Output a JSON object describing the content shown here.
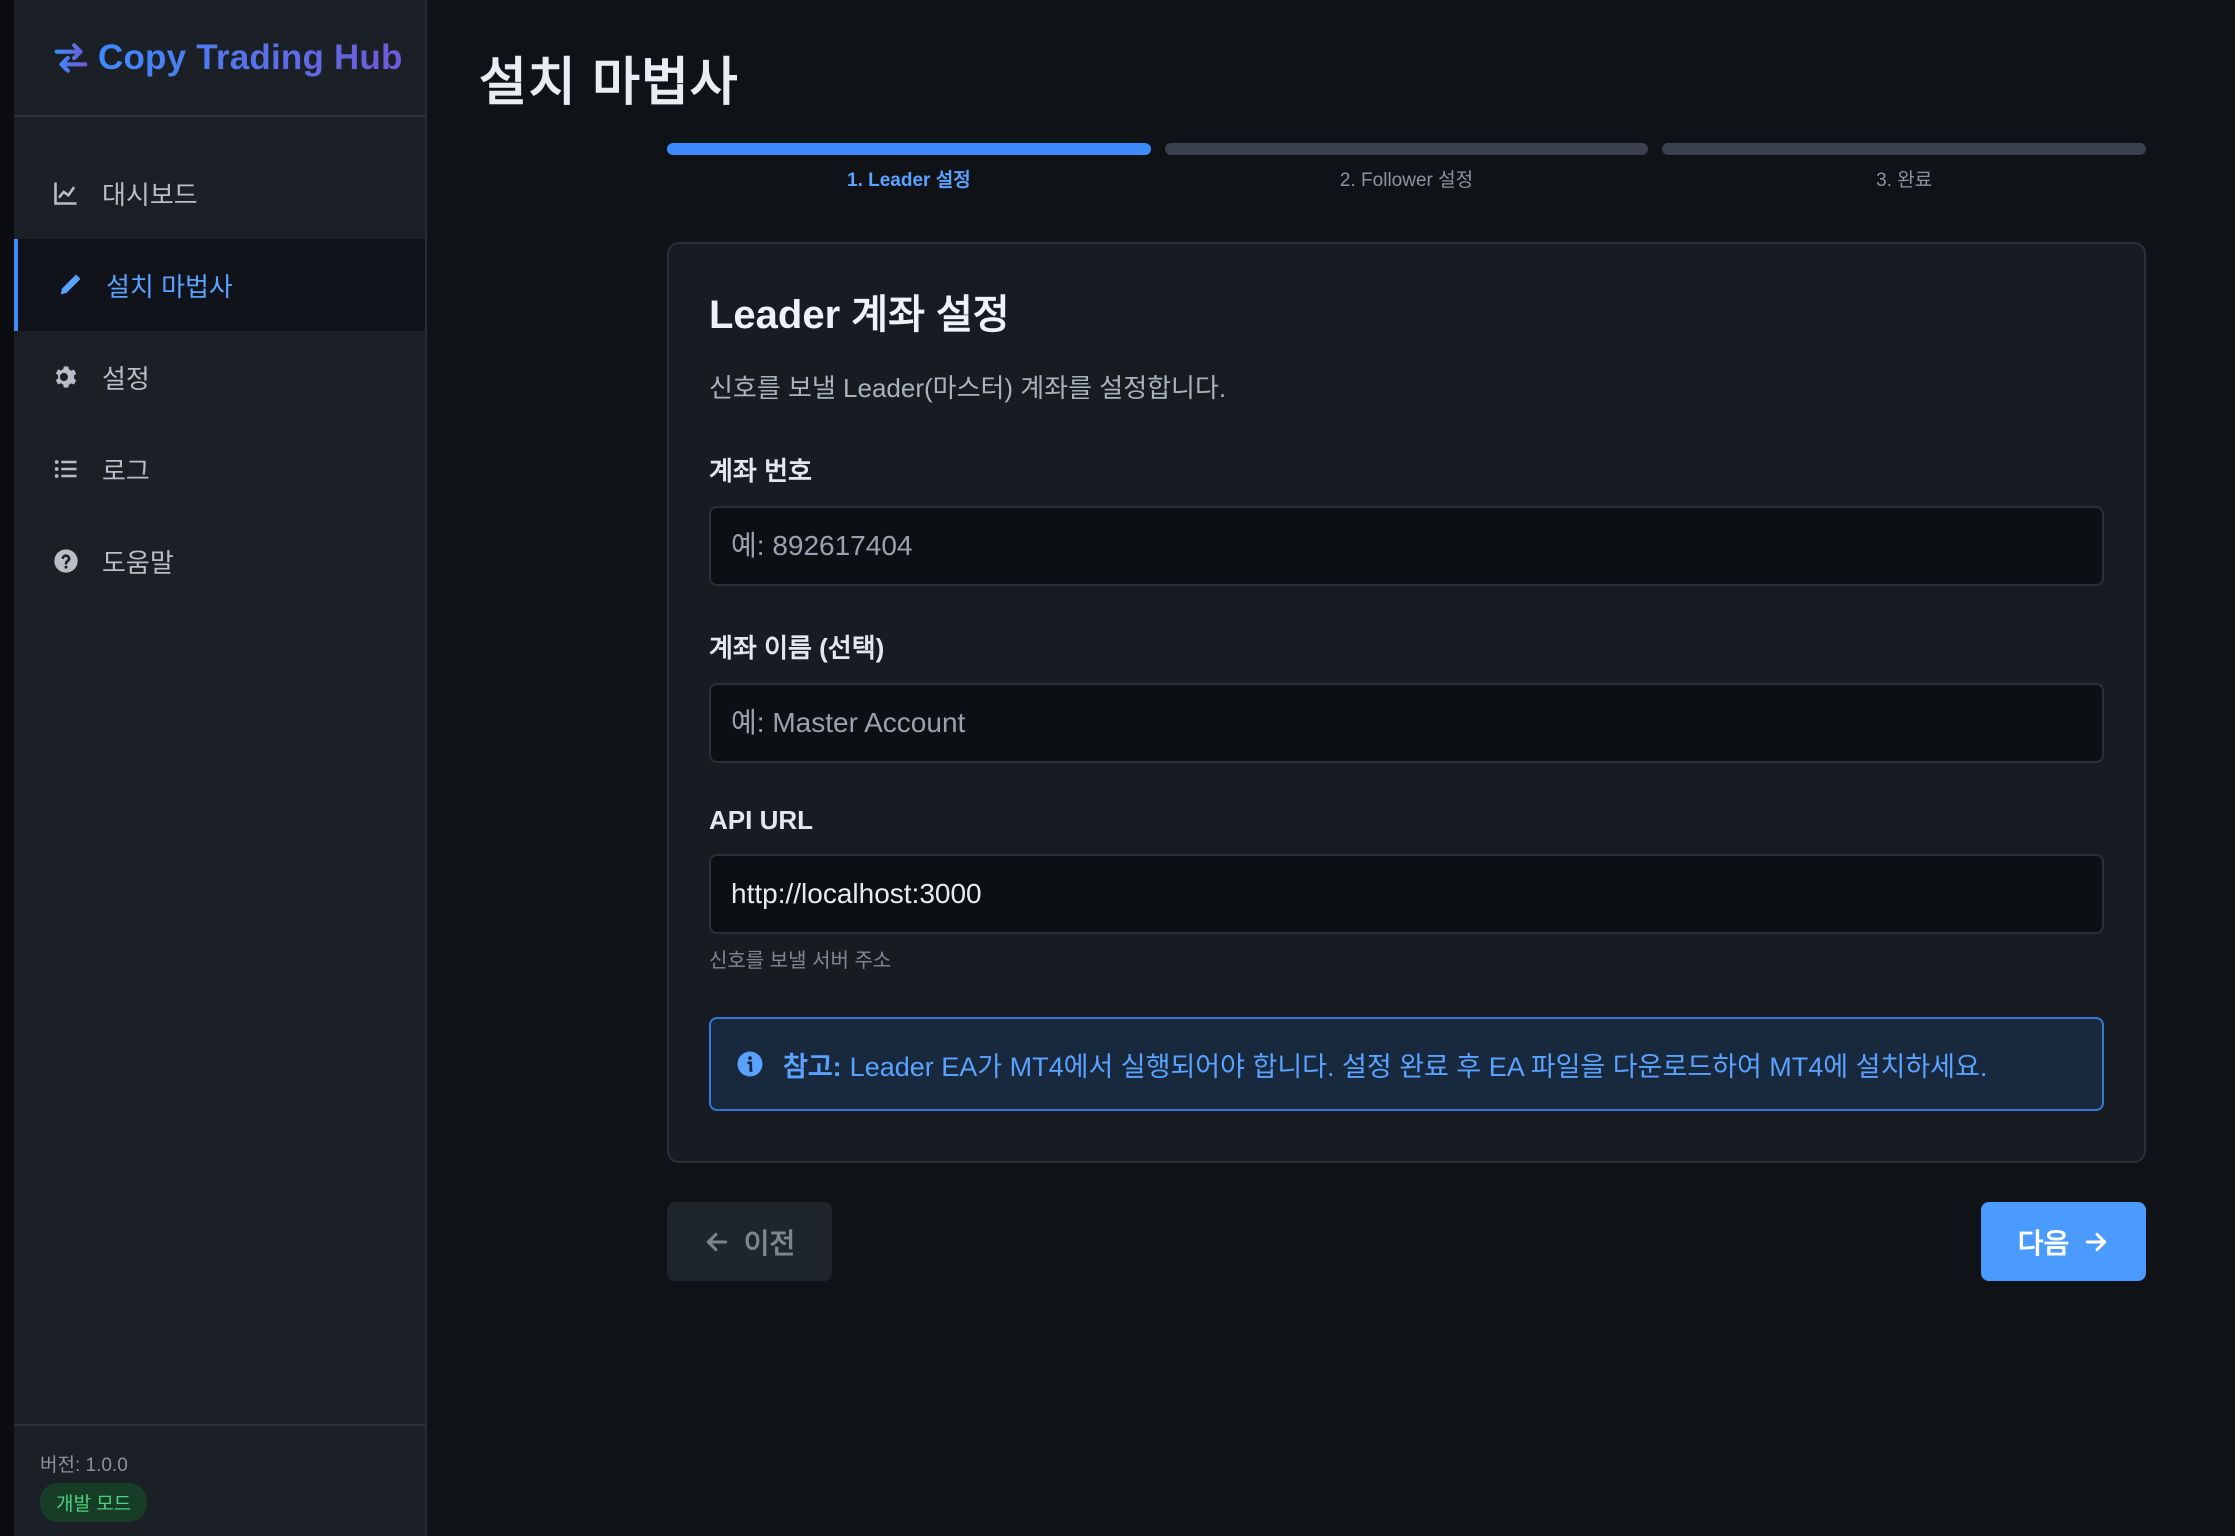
{
  "brand": {
    "title": "Copy Trading Hub",
    "icon": "exchange-arrows-icon"
  },
  "sidebar": {
    "items": [
      {
        "label": "대시보드",
        "icon": "chart-line-icon"
      },
      {
        "label": "설치 마법사",
        "icon": "pencil-icon",
        "active": true
      },
      {
        "label": "설정",
        "icon": "gear-icon"
      },
      {
        "label": "로그",
        "icon": "list-icon"
      },
      {
        "label": "도움말",
        "icon": "question-circle-icon"
      }
    ],
    "version": "버전: 1.0.0",
    "mode_badge": "개발 모드"
  },
  "main": {
    "title": "설치 마법사",
    "steps": [
      {
        "label": "1. Leader 설정",
        "active": true
      },
      {
        "label": "2. Follower 설정",
        "active": false
      },
      {
        "label": "3. 완료",
        "active": false
      }
    ],
    "card": {
      "title": "Leader 계좌 설정",
      "description": "신호를 보낼 Leader(마스터) 계좌를 설정합니다.",
      "account_number": {
        "label": "계좌 번호",
        "placeholder": "예: 892617404",
        "value": ""
      },
      "account_name": {
        "label": "계좌 이름 (선택)",
        "placeholder": "예: Master Account",
        "value": ""
      },
      "api_url": {
        "label": "API URL",
        "value": "http://localhost:3000",
        "help": "신호를 보낼 서버 주소"
      },
      "note": {
        "title": "참고:",
        "text": "Leader EA가 MT4에서 실행되어야 합니다. 설정 완료 후 EA 파일을 다운로드하여 MT4에 설치하세요.",
        "icon": "info-circle-icon"
      }
    },
    "buttons": {
      "prev": "이전",
      "next": "다음"
    }
  },
  "colors": {
    "accent": "#3d8bfd",
    "background": "#0f1318",
    "sidebar": "#1b2027",
    "success": "#4bd27b"
  }
}
